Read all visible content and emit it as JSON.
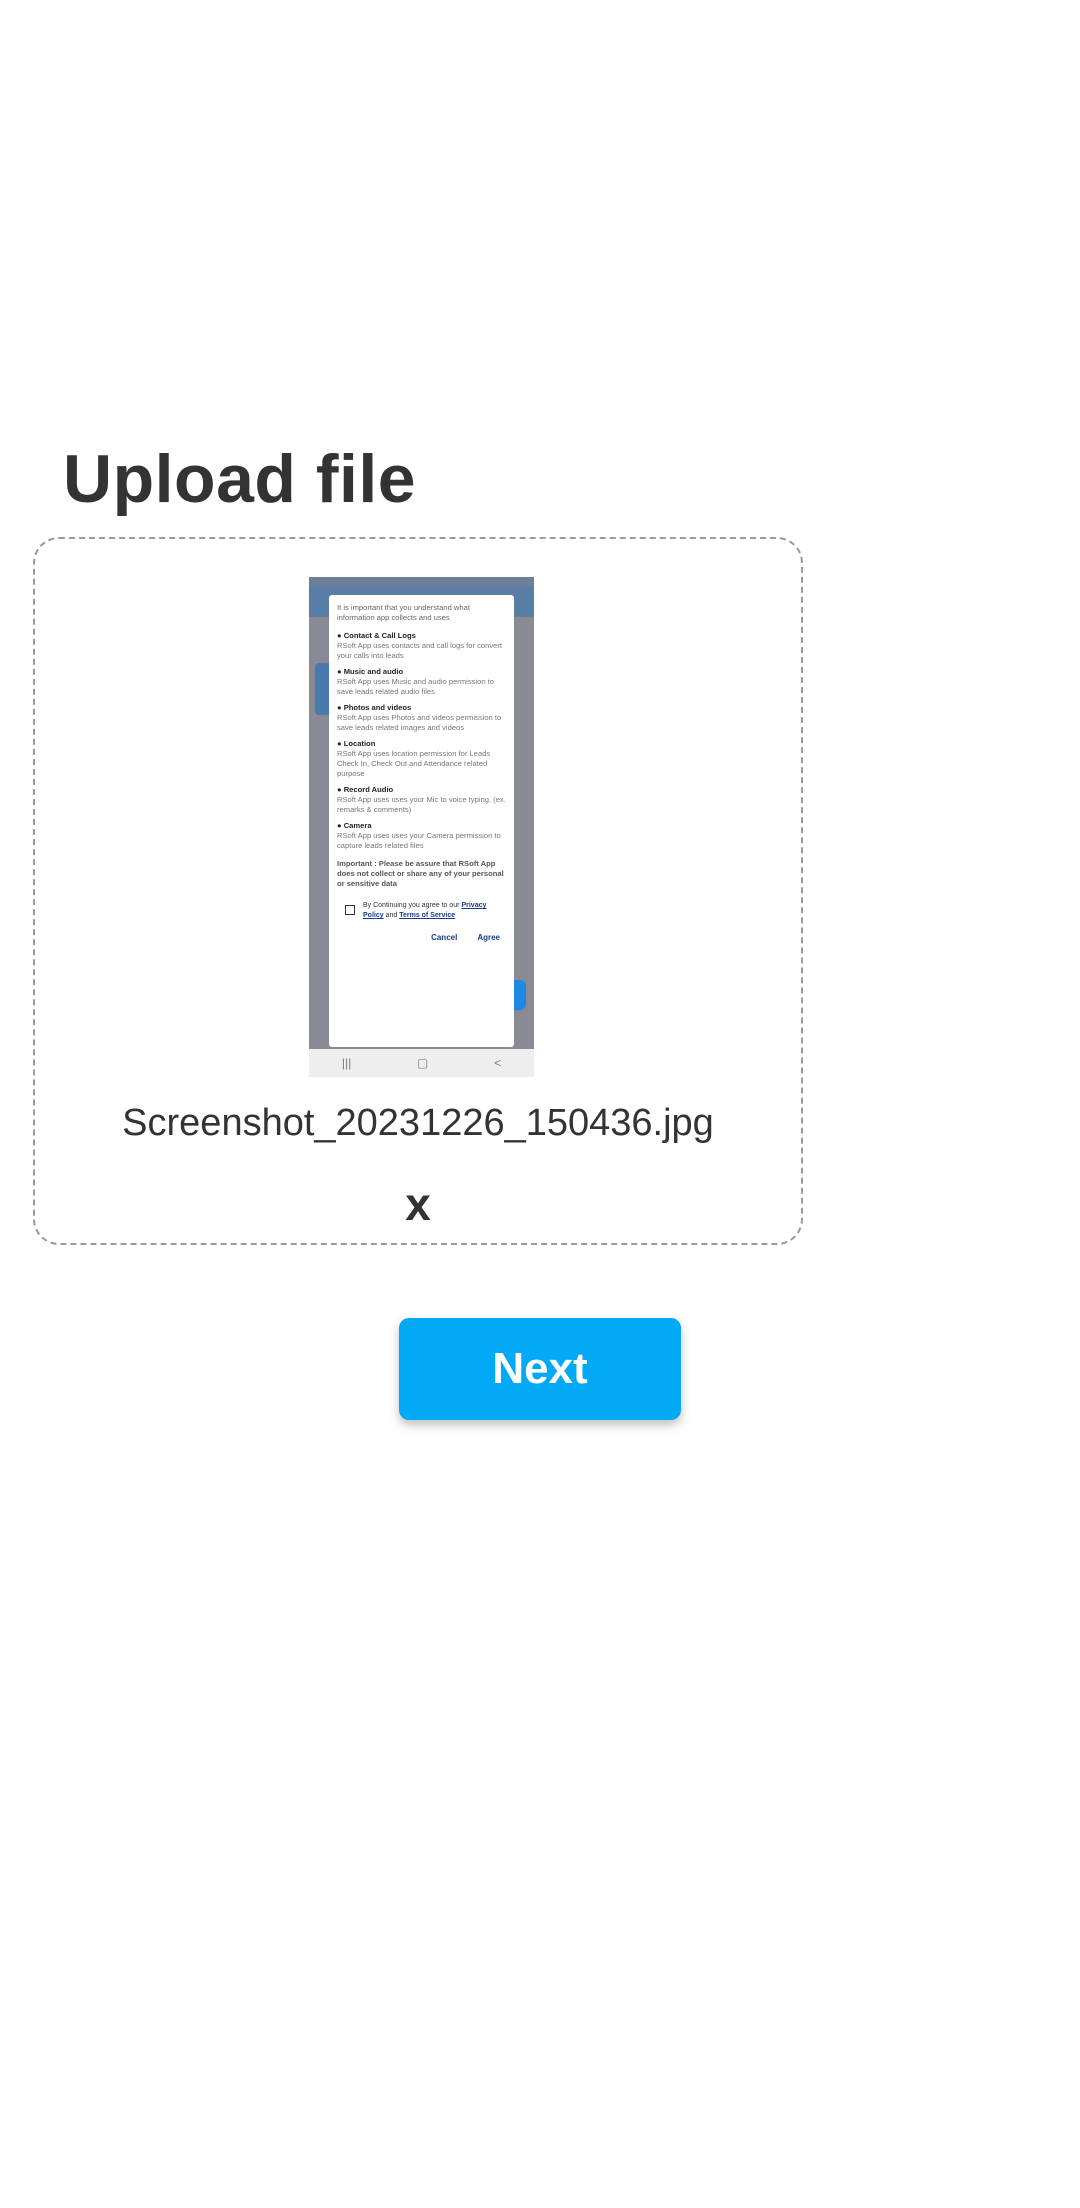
{
  "page": {
    "title": "Upload file"
  },
  "upload": {
    "file_name": "Screenshot_20231226_150436.jpg",
    "remove_label": "x",
    "preview": {
      "dialog_intro": "It is important that you understand what information app collects and uses",
      "sections": [
        {
          "title": "● Contact & Call Logs",
          "body": "RSoft App uses contacts and call logs for convert your calls into leads"
        },
        {
          "title": "● Music and audio",
          "body": "RSoft App uses Music and audio permission to save leads related audio files"
        },
        {
          "title": "● Photos and videos",
          "body": "RSoft App uses Photos and videos permission to save leads related images and videos"
        },
        {
          "title": "● Location",
          "body": "RSoft App uses location permission for Leads Check In, Check Out and Attendance related purpose"
        },
        {
          "title": "● Record Audio",
          "body": "RSoft App uses uses your Mic to voice typing. (ex. remarks & comments)"
        },
        {
          "title": "● Camera",
          "body": "RSoft App uses uses your Camera permission to capture leads related files"
        }
      ],
      "important": "Important : Please be assure that RSoft App does not collect or share any of your personal or sensitive data",
      "consent_prefix": "By Continuing you agree to our",
      "privacy_link": "Privacy Policy",
      "consent_and": "and",
      "terms_link": "Terms of Service",
      "cancel_label": "Cancel",
      "agree_label": "Agree",
      "nav_icons": [
        "|||",
        "▢",
        "<"
      ]
    }
  },
  "actions": {
    "next_label": "Next"
  },
  "colors": {
    "accent": "#03a9f4",
    "text": "#333333",
    "border": "#9a9a9a"
  }
}
